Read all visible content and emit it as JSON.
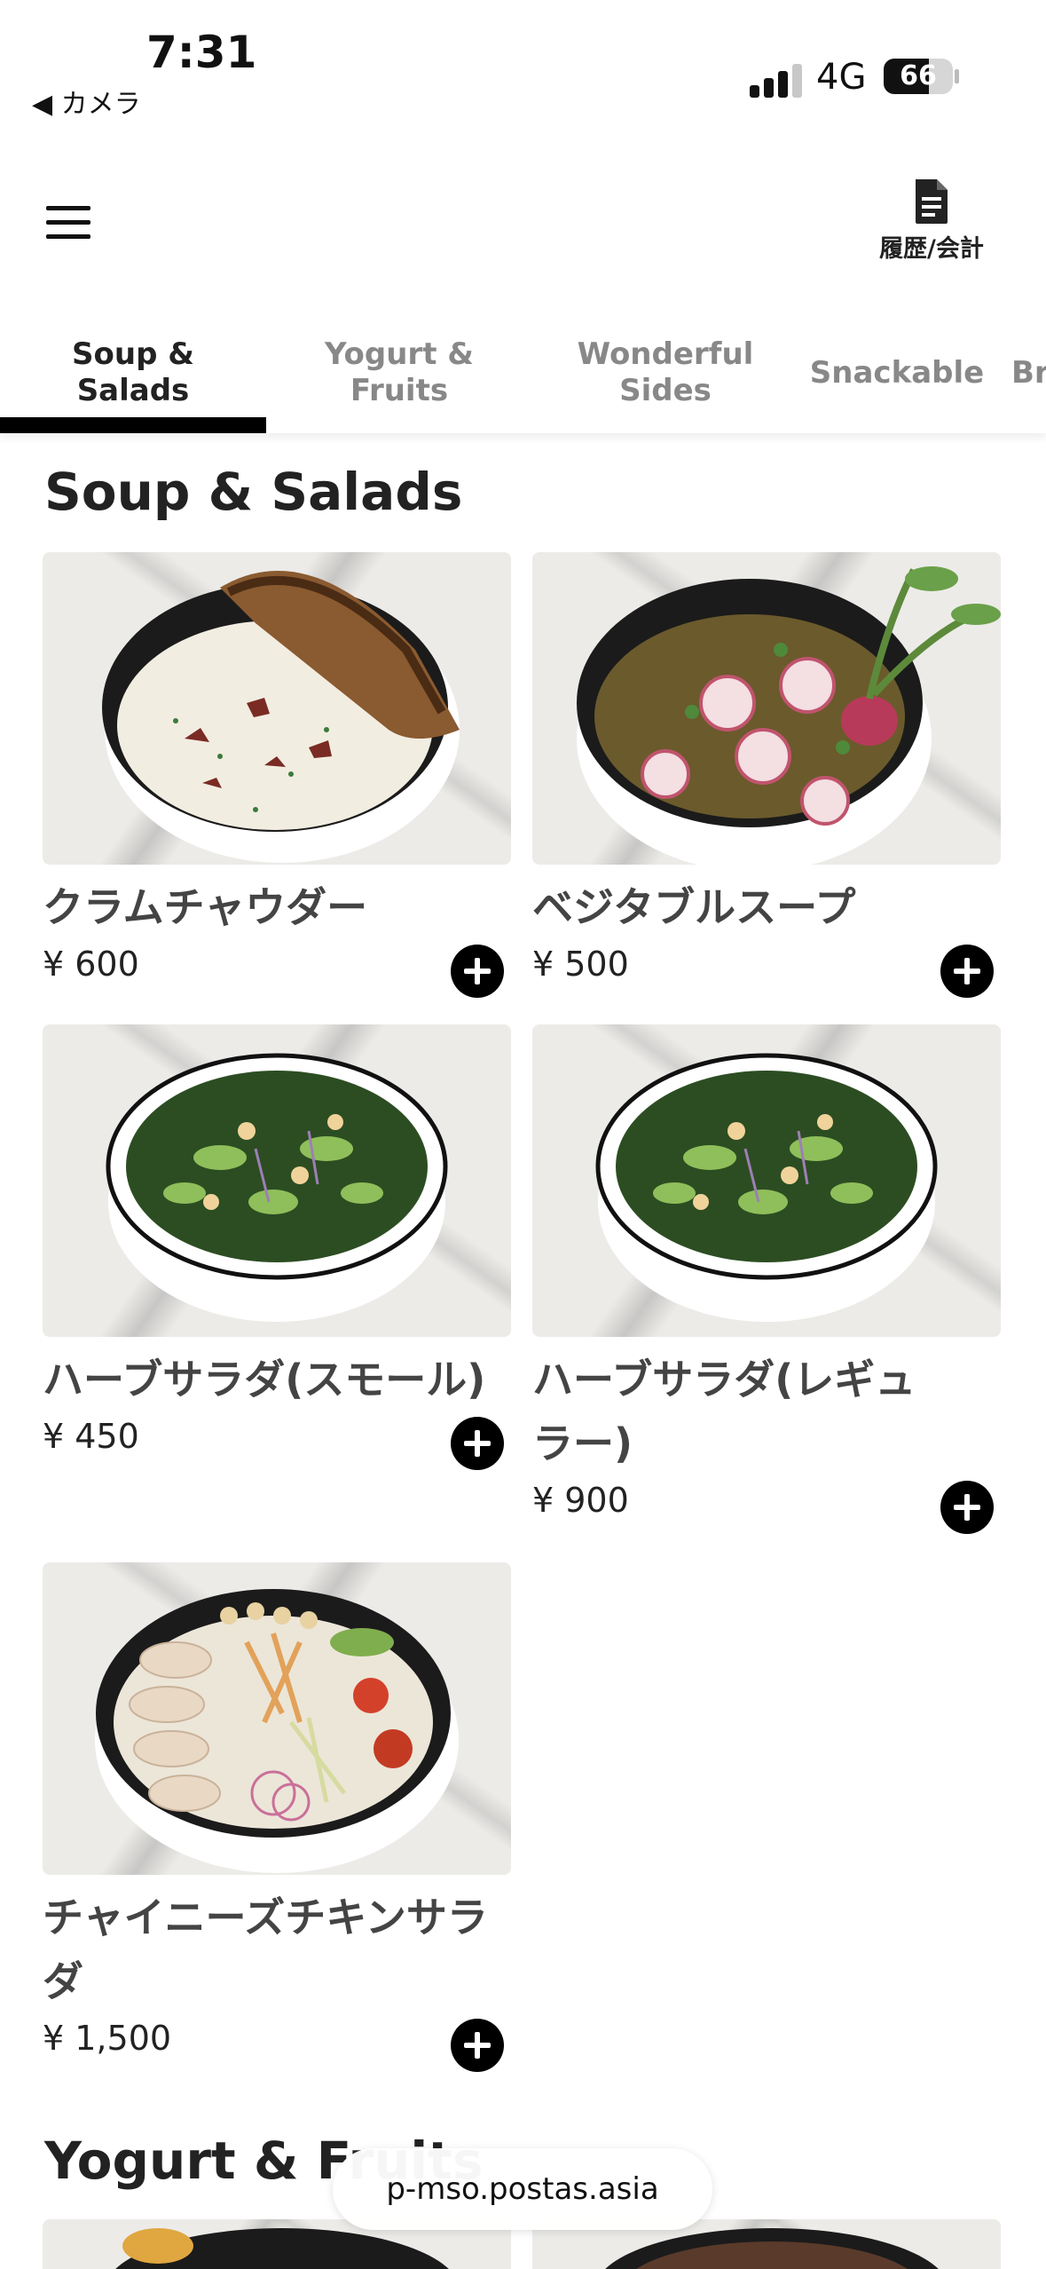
{
  "status_bar": {
    "time": "7:31",
    "back_app": "◀ カメラ",
    "network": "4G",
    "battery": "66",
    "battery_level": 0.66
  },
  "header": {
    "history_label": "履歴/会計"
  },
  "tabs": [
    {
      "label": "Soup &\nSalads",
      "active": true
    },
    {
      "label": "Yogurt &\nFruits",
      "active": false
    },
    {
      "label": "Wonderful\nSides",
      "active": false
    },
    {
      "label": "Snackable",
      "active": false
    },
    {
      "label": "Br",
      "active": false
    }
  ],
  "sections": [
    {
      "title": "Soup & Salads",
      "items": [
        {
          "name": "クラムチャウダー",
          "price": "¥ 600",
          "image": "clam-chowder"
        },
        {
          "name": "ベジタブルスープ",
          "price": "¥ 500",
          "image": "vegetable-soup"
        },
        {
          "name": "ハーブサラダ(スモール)",
          "price": "¥ 450",
          "image": "herb-salad"
        },
        {
          "name": "ハーブサラダ(レギュ\nラー)",
          "price": "¥ 900",
          "image": "herb-salad"
        },
        {
          "name": "チャイニーズチキンサラ\nダ",
          "price": "¥ 1,500",
          "image": "chinese-chicken-salad"
        }
      ]
    },
    {
      "title": "Yogurt & Fruits"
    }
  ],
  "browser": {
    "url": "p-mso.postas.asia"
  }
}
